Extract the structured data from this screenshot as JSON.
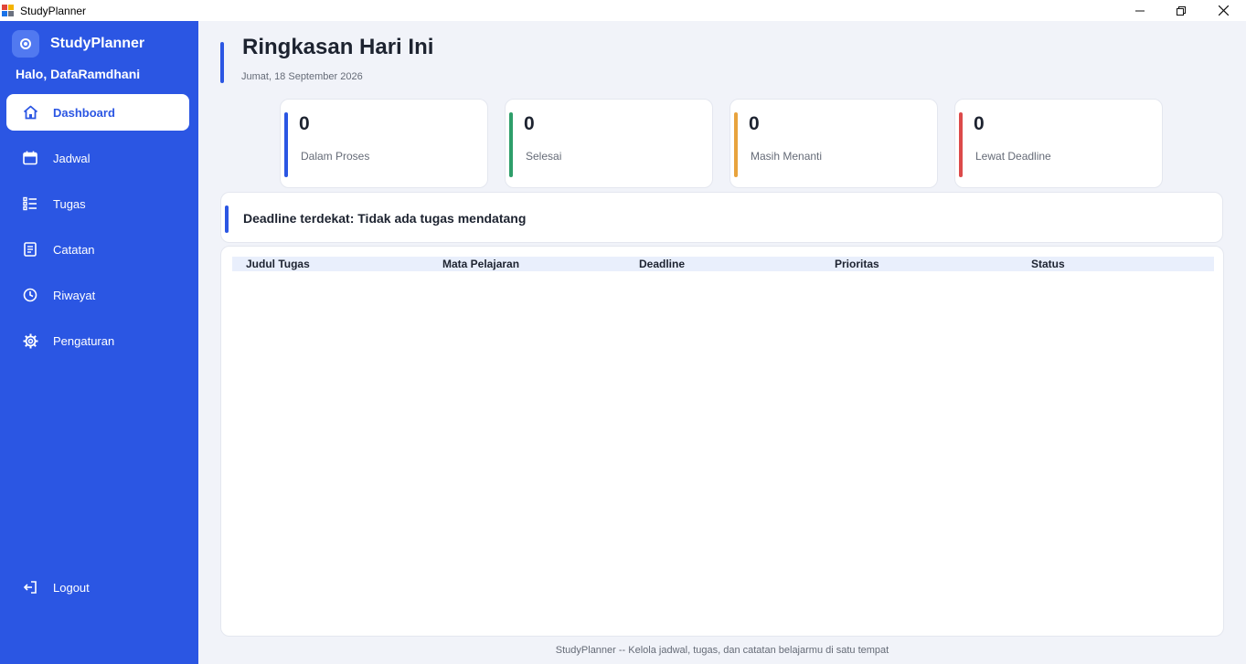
{
  "window": {
    "title": "StudyPlanner"
  },
  "sidebar": {
    "brand": "StudyPlanner",
    "greeting": "Halo, DafaRamdhani",
    "items": [
      {
        "label": "Dashboard",
        "icon": "home-icon",
        "active": true
      },
      {
        "label": "Jadwal",
        "icon": "calendar-icon"
      },
      {
        "label": "Tugas",
        "icon": "checklist-icon"
      },
      {
        "label": "Catatan",
        "icon": "note-icon"
      },
      {
        "label": "Riwayat",
        "icon": "clock-icon"
      },
      {
        "label": "Pengaturan",
        "icon": "gear-icon"
      }
    ],
    "logout": {
      "label": "Logout",
      "icon": "logout-icon"
    }
  },
  "header": {
    "title": "Ringkasan Hari Ini",
    "date": "Jumat, 18 September 2026"
  },
  "stats": [
    {
      "value": "0",
      "label": "Dalam Proses",
      "color": "#2b56e3"
    },
    {
      "value": "0",
      "label": "Selesai",
      "color": "#2e9e6a"
    },
    {
      "value": "0",
      "label": "Masih Menanti",
      "color": "#e8a33d"
    },
    {
      "value": "0",
      "label": "Lewat Deadline",
      "color": "#dc4a4a"
    }
  ],
  "deadline": {
    "text": "Deadline terdekat: Tidak ada tugas mendatang"
  },
  "table": {
    "columns": [
      "Judul Tugas",
      "Mata Pelajaran",
      "Deadline",
      "Prioritas",
      "Status"
    ],
    "rows": []
  },
  "footer": {
    "text": "StudyPlanner -- Kelola jadwal, tugas, dan catatan belajarmu di satu tempat"
  },
  "colors": {
    "accent": "#2b56e3",
    "background": "#f1f3f9"
  }
}
